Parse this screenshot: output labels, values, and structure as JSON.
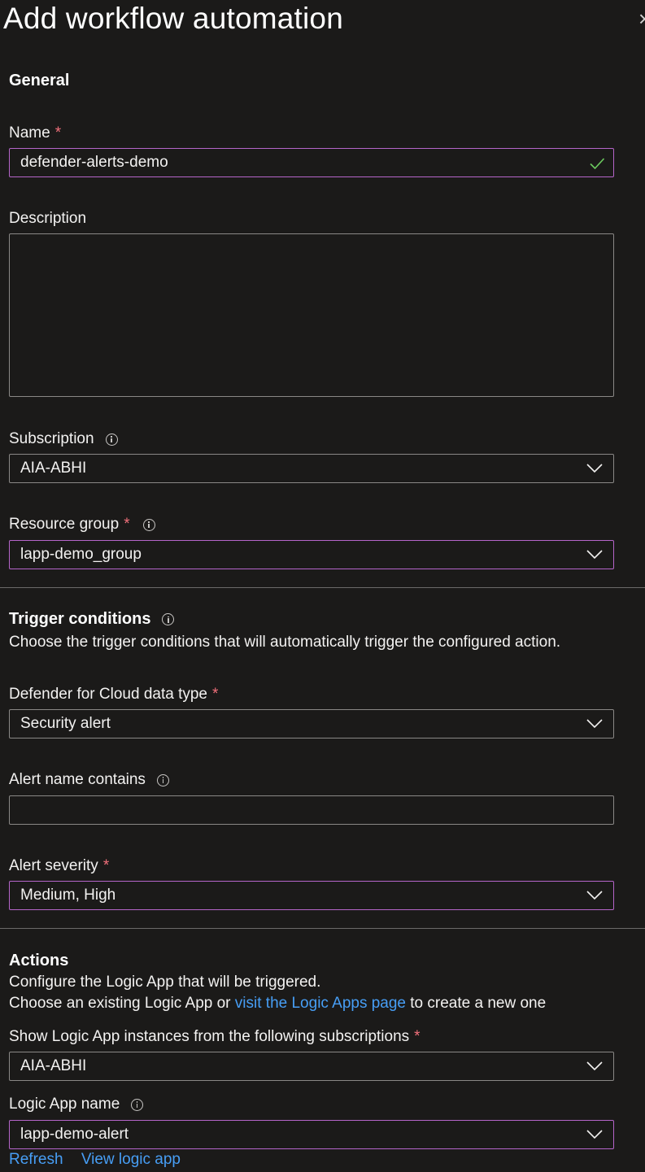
{
  "header": {
    "title": "Add workflow automation",
    "close_symbol": "×"
  },
  "general": {
    "heading": "General",
    "name": {
      "label": "Name",
      "required_mark": "*",
      "value": "defender-alerts-demo"
    },
    "description": {
      "label": "Description",
      "value": ""
    },
    "subscription": {
      "label": "Subscription",
      "value": "AIA-ABHI"
    },
    "resource_group": {
      "label": "Resource group",
      "required_mark": "*",
      "value": "lapp-demo_group"
    }
  },
  "trigger": {
    "heading": "Trigger conditions",
    "description": "Choose the trigger conditions that will automatically trigger the configured action.",
    "data_type": {
      "label": "Defender for Cloud data type",
      "required_mark": "*",
      "value": "Security alert"
    },
    "alert_name": {
      "label": "Alert name contains",
      "value": ""
    },
    "severity": {
      "label": "Alert severity",
      "required_mark": "*",
      "value": "Medium, High"
    }
  },
  "actions": {
    "heading": "Actions",
    "line1": "Configure the Logic App that will be triggered.",
    "line2_prefix": "Choose an existing Logic App or ",
    "line2_link": "visit the Logic Apps page",
    "line2_suffix": " to create a new one",
    "subscriptions": {
      "label": "Show Logic App instances from the following subscriptions",
      "required_mark": "*",
      "value": "AIA-ABHI"
    },
    "logic_app": {
      "label": "Logic App name",
      "value": "lapp-demo-alert"
    },
    "refresh_link": "Refresh",
    "view_link": "View logic app"
  },
  "colors": {
    "background": "#1b1a19",
    "focus_border": "#b565c9",
    "link": "#479ef5",
    "required": "#f1707b",
    "valid_check": "#6ccb5f"
  },
  "icons": [
    "close-icon",
    "checkmark-icon",
    "info-icon",
    "chevron-down-icon"
  ]
}
